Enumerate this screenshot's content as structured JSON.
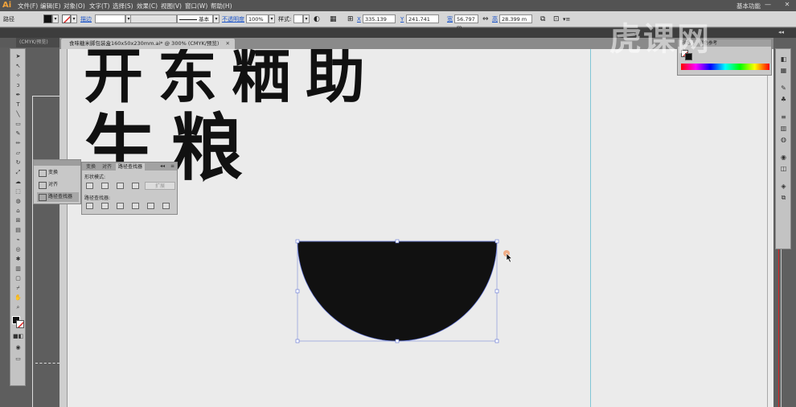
{
  "menubar": {
    "logo": "Ai",
    "menus": [
      "文件(F)",
      "编辑(E)",
      "对象(O)",
      "文字(T)",
      "选择(S)",
      "效果(C)",
      "视图(V)",
      "窗口(W)",
      "帮助(H)"
    ],
    "workspace": "基本功能",
    "win_min": "—",
    "win_close": "✕"
  },
  "control": {
    "object_type": "路径",
    "stroke_label": "描边",
    "stroke_style": "基本",
    "opacity_label": "不透明度",
    "opacity_value": "100%",
    "style_label": "样式:",
    "x_label": "X",
    "x_value": "335.139",
    "y_label": "Y",
    "y_value": "241.741",
    "w_label": "宽",
    "w_value": "56.797 m",
    "h_label": "高",
    "h_value": "28.399 m"
  },
  "document": {
    "left_tab": "(CMYK/预览)",
    "tab_title": "食味糖米脚包装盒160x50x230mm.ai* @ 300% (CMYK/预览)",
    "tab_close": "✕",
    "line1": "开东粞助",
    "line2": "生粮"
  },
  "nav_panel": {
    "items": [
      "变换",
      "对齐",
      "路径查找器"
    ]
  },
  "pathfinder": {
    "tabs": [
      "变换",
      "对齐",
      "路径查找器"
    ],
    "shape_modes_label": "形状模式:",
    "pathfinders_label": "路径查找器:",
    "expand_label": "扩展"
  },
  "color_panel": {
    "tabs": [
      "颜色",
      "颜色参考"
    ]
  },
  "watermark": "虎课网",
  "colors": {
    "selection": "#5b6fd6",
    "shape_fill": "#111111",
    "guide": "#7fc6d6"
  }
}
